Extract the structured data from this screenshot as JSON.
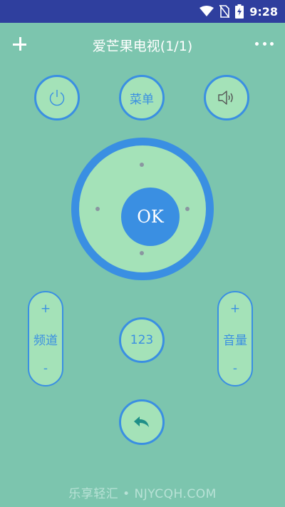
{
  "status": {
    "time": "9:28"
  },
  "appbar": {
    "title": "爱芒果电视(1/1)"
  },
  "remote": {
    "menu_label": "菜单",
    "ok_label": "OK",
    "channel": {
      "plus": "+",
      "label": "频道",
      "minus": "-"
    },
    "volume": {
      "plus": "+",
      "label": "音量",
      "minus": "-"
    },
    "numpad_label": "123"
  },
  "footer": {
    "watermark": "乐享轻汇 • NJYCQH.COM"
  },
  "colors": {
    "background": "#7cc5ae",
    "accent": "#3a8fe2",
    "button_fill": "#a4e2b8",
    "statusbar": "#2f3f9e"
  },
  "icons": [
    "wifi-icon",
    "no-sim-icon",
    "battery-icon",
    "plus-icon",
    "more-icon",
    "power-icon",
    "volume-icon",
    "back-arrow-icon"
  ]
}
